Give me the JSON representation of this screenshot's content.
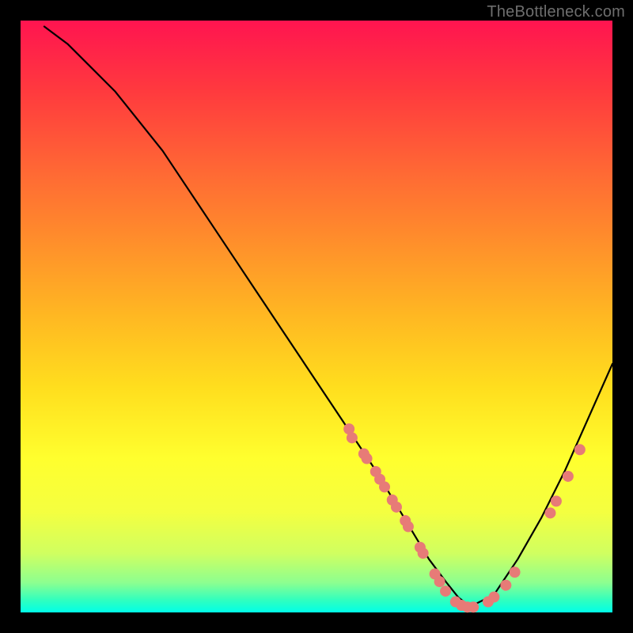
{
  "watermark": {
    "text": "TheBottleneck.com"
  },
  "chart_data": {
    "type": "line",
    "title": "",
    "xlabel": "",
    "ylabel": "",
    "xlim": [
      0,
      100
    ],
    "ylim": [
      0,
      100
    ],
    "grid": false,
    "legend": false,
    "series": [
      {
        "name": "bottleneck-curve",
        "x": [
          4,
          8,
          12,
          16,
          20,
          24,
          28,
          32,
          36,
          40,
          44,
          48,
          52,
          56,
          60,
          63,
          66,
          69,
          72,
          74,
          76,
          80,
          84,
          88,
          92,
          96,
          100
        ],
        "y": [
          99,
          96,
          92,
          88,
          83,
          78,
          72,
          66,
          60,
          54,
          48,
          42,
          36,
          30,
          24,
          19,
          14,
          9,
          5,
          2.5,
          1,
          3,
          9,
          16,
          24,
          33,
          42
        ]
      }
    ],
    "markers": {
      "name": "highlight-points",
      "color": "#e77b77",
      "points": [
        {
          "x": 55.5,
          "y": 31.0
        },
        {
          "x": 56.0,
          "y": 29.5
        },
        {
          "x": 58.0,
          "y": 26.8
        },
        {
          "x": 58.5,
          "y": 26.0
        },
        {
          "x": 60.0,
          "y": 23.8
        },
        {
          "x": 60.7,
          "y": 22.5
        },
        {
          "x": 61.5,
          "y": 21.2
        },
        {
          "x": 62.8,
          "y": 19.0
        },
        {
          "x": 63.5,
          "y": 17.8
        },
        {
          "x": 65.0,
          "y": 15.5
        },
        {
          "x": 65.5,
          "y": 14.5
        },
        {
          "x": 67.5,
          "y": 11.0
        },
        {
          "x": 68.0,
          "y": 10.0
        },
        {
          "x": 70.0,
          "y": 6.5
        },
        {
          "x": 70.8,
          "y": 5.2
        },
        {
          "x": 71.8,
          "y": 3.6
        },
        {
          "x": 73.5,
          "y": 1.8
        },
        {
          "x": 74.5,
          "y": 1.2
        },
        {
          "x": 75.5,
          "y": 0.9
        },
        {
          "x": 76.5,
          "y": 0.9
        },
        {
          "x": 79.0,
          "y": 1.8
        },
        {
          "x": 80.0,
          "y": 2.6
        },
        {
          "x": 82.0,
          "y": 4.6
        },
        {
          "x": 83.5,
          "y": 6.8
        },
        {
          "x": 89.5,
          "y": 16.8
        },
        {
          "x": 90.5,
          "y": 18.8
        },
        {
          "x": 92.5,
          "y": 23.0
        },
        {
          "x": 94.5,
          "y": 27.5
        }
      ]
    }
  }
}
